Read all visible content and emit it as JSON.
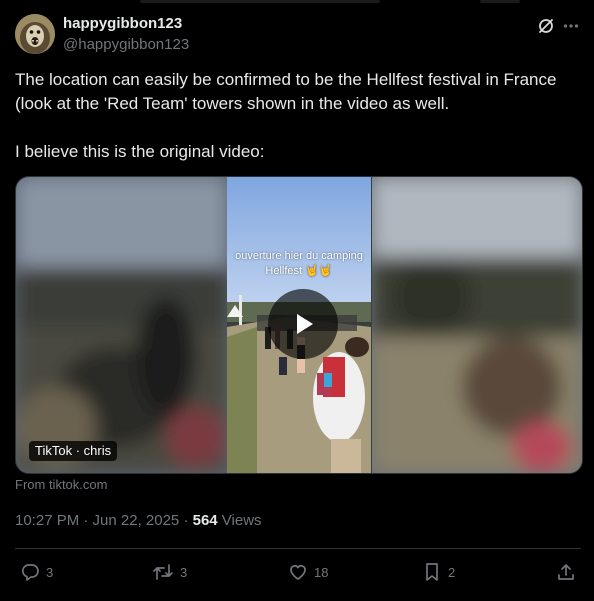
{
  "tweet": {
    "author": {
      "display_name": "happygibbon123",
      "handle": "@happygibbon123",
      "avatar": "gibbon-avatar-photo"
    },
    "header_icons": [
      "grok-icon",
      "more-icon"
    ],
    "text_paragraphs": [
      "The location can easily be confirmed to be the Hellfest festival in France (look at the 'Red Team' towers shown in the video as well.",
      "I believe this is the original video:"
    ],
    "media": {
      "caption": "ouverture hier du camping Hellfest 🤘🤘",
      "badge": "TikTok · chris",
      "play_icon": "play-icon"
    },
    "source": "From tiktok.com",
    "timestamp": "10:27 PM · Jun 22, 2025 · ",
    "views_count": "564",
    "views_label": " Views",
    "actions": {
      "replies": {
        "icon": "reply-icon",
        "count": "3"
      },
      "reposts": {
        "icon": "repost-icon",
        "count": "3"
      },
      "likes": {
        "icon": "heart-icon",
        "count": "18"
      },
      "bookmarks": {
        "icon": "bookmark-icon",
        "count": "2"
      },
      "share": {
        "icon": "share-icon"
      }
    }
  },
  "colors": {
    "background": "#000000",
    "text_primary": "#e7e9ea",
    "text_secondary": "#71767b",
    "border": "#2f3336"
  }
}
